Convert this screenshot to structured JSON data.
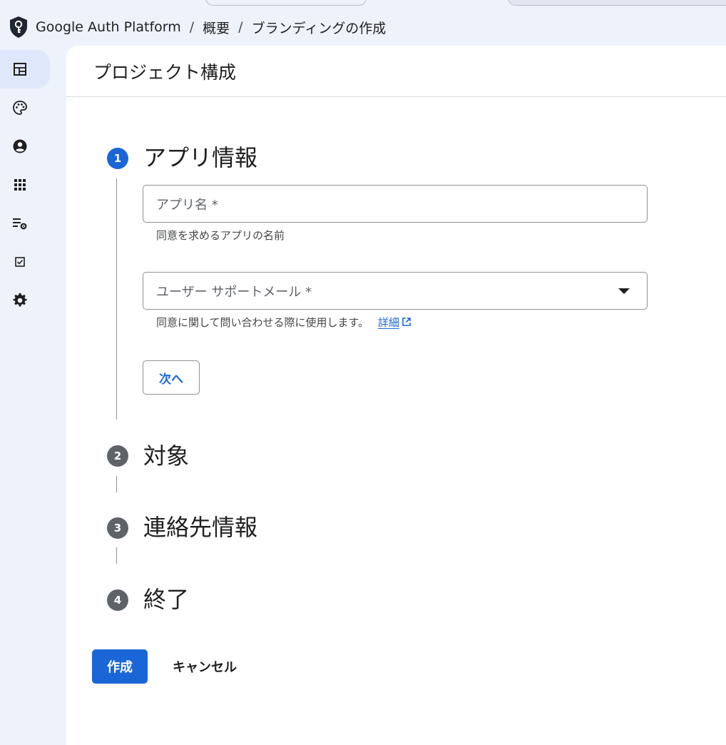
{
  "breadcrumb": {
    "app": "Google Auth Platform",
    "separator": "/",
    "level1": "概要",
    "level2": "ブランディングの作成"
  },
  "page": {
    "title": "プロジェクト構成"
  },
  "sidebar": {
    "items": [
      {
        "icon": "dashboard-icon",
        "active": true
      },
      {
        "icon": "palette-icon",
        "active": false
      },
      {
        "icon": "account-circle-icon",
        "active": false
      },
      {
        "icon": "apps-grid-icon",
        "active": false
      },
      {
        "icon": "list-settings-icon",
        "active": false
      },
      {
        "icon": "checkbox-icon",
        "active": false
      },
      {
        "icon": "settings-gear-icon",
        "active": false
      }
    ]
  },
  "steps": [
    {
      "number": "1",
      "title": "アプリ情報",
      "active": true
    },
    {
      "number": "2",
      "title": "対象",
      "active": false
    },
    {
      "number": "3",
      "title": "連絡先情報",
      "active": false
    },
    {
      "number": "4",
      "title": "終了",
      "active": false
    }
  ],
  "form": {
    "app_name": {
      "placeholder": "アプリ名 *",
      "value": "",
      "hint": "同意を求めるアプリの名前"
    },
    "support_email": {
      "placeholder": "ユーザー サポートメール *",
      "value": "",
      "hint": "同意に関して問い合わせる際に使用します。",
      "link": "詳細"
    },
    "next_label": "次へ"
  },
  "actions": {
    "create_label": "作成",
    "cancel_label": "キャンセル"
  },
  "colors": {
    "accent": "#1b66d6",
    "background": "#eef2fb",
    "inactive_step": "#5f6368"
  }
}
